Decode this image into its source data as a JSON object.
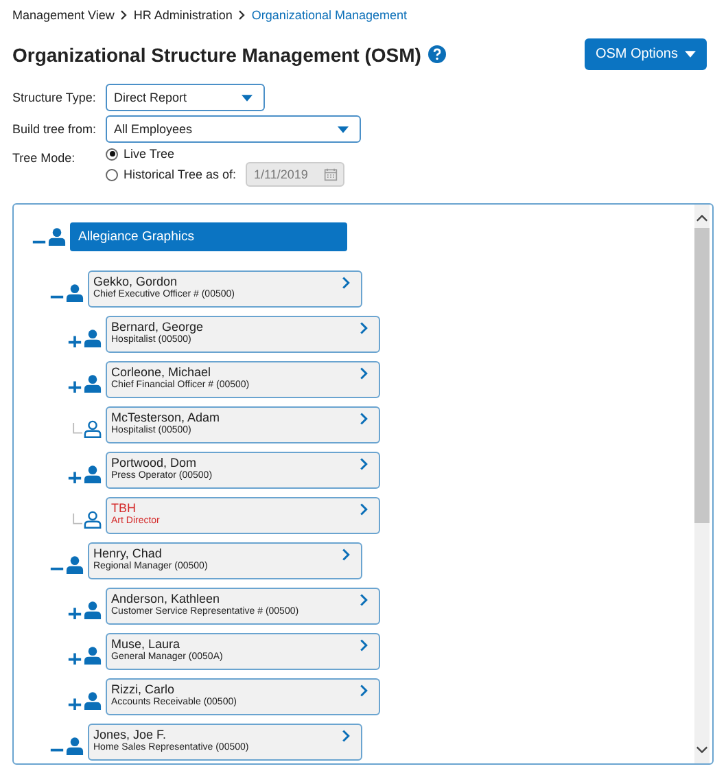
{
  "breadcrumb": [
    {
      "label": "Management View",
      "current": false
    },
    {
      "label": "HR Administration",
      "current": false
    },
    {
      "label": "Organizational Management",
      "current": true
    }
  ],
  "title": "Organizational Structure Management (OSM)",
  "options_button": "OSM Options",
  "form": {
    "structure_type": {
      "label": "Structure Type:",
      "value": "Direct Report"
    },
    "build_tree_from": {
      "label": "Build tree from:",
      "value": "All Employees"
    },
    "tree_mode": {
      "label": "Tree Mode:",
      "options": [
        {
          "label": "Live Tree",
          "selected": true
        },
        {
          "label": "Historical Tree as of:",
          "selected": false
        }
      ],
      "date": "1/11/2019"
    }
  },
  "tree": {
    "label": "Allegiance Graphics",
    "expanded": true,
    "children": [
      {
        "kind": "parent",
        "name": "Gekko, Gordon",
        "position": "Chief Executive Officer # (00500)",
        "expanded": true,
        "vacant": false,
        "children": [
          {
            "kind": "parent",
            "name": "Bernard, George",
            "position": "Hospitalist (00500)",
            "expanded": false,
            "vacant": false
          },
          {
            "kind": "parent",
            "name": "Corleone, Michael",
            "position": "Chief Financial Officer # (00500)",
            "expanded": false,
            "vacant": false
          },
          {
            "kind": "leaf",
            "name": "McTesterson, Adam",
            "position": "Hospitalist (00500)",
            "vacant": false
          },
          {
            "kind": "parent",
            "name": "Portwood, Dom",
            "position": "Press Operator (00500)",
            "expanded": false,
            "vacant": false
          },
          {
            "kind": "leaf",
            "name": "TBH",
            "position": "Art Director",
            "vacant": true
          }
        ]
      },
      {
        "kind": "parent",
        "name": "Henry, Chad",
        "position": "Regional Manager (00500)",
        "expanded": true,
        "vacant": false,
        "children": [
          {
            "kind": "parent",
            "name": "Anderson, Kathleen",
            "position": "Customer Service Representative # (00500)",
            "expanded": false,
            "vacant": false
          },
          {
            "kind": "parent",
            "name": "Muse, Laura",
            "position": "General Manager (0050A)",
            "expanded": false,
            "vacant": false
          },
          {
            "kind": "parent",
            "name": "Rizzi, Carlo",
            "position": "Accounts Receivable (00500)",
            "expanded": false,
            "vacant": false
          }
        ]
      },
      {
        "kind": "parent",
        "name": "Jones, Joe F.",
        "position": "Home Sales Representative (00500)",
        "expanded": true,
        "vacant": false
      }
    ]
  }
}
